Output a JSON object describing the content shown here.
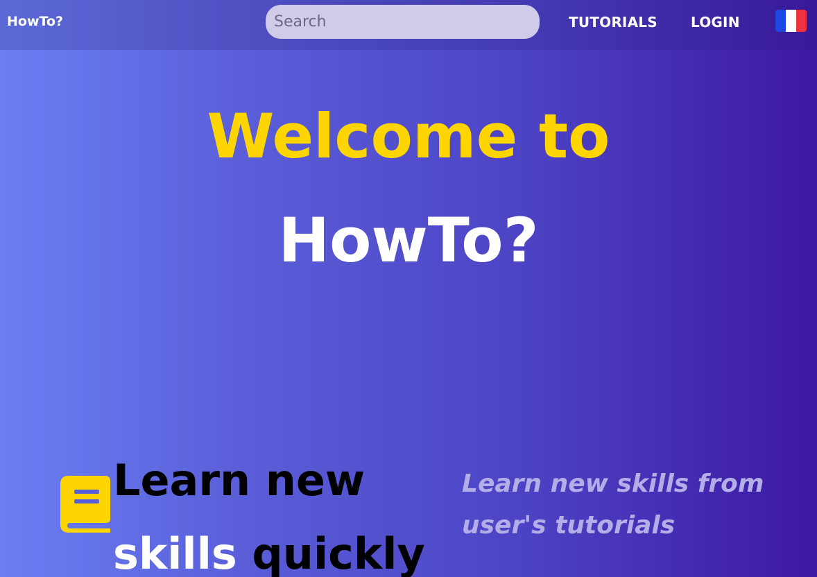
{
  "navbar": {
    "brand": "HowTo?",
    "search_placeholder": "Search",
    "links": [
      {
        "label": "TUTORIALS"
      },
      {
        "label": "LOGIN"
      }
    ],
    "language_flag": "france-flag-icon"
  },
  "hero": {
    "line1": "Welcome to",
    "line2": "HowTo?"
  },
  "feature": {
    "icon": "book-icon",
    "title_part1": "Learn new",
    "title_part2_white": "skills",
    "title_part3": " quickly",
    "subtitle": "Learn new skills from user's tutorials"
  },
  "colors": {
    "accent_yellow": "#ffd500",
    "gradient_start": "#6a7ff2",
    "gradient_end": "#3d18a2",
    "subtitle": "#b4aee8",
    "flag_blue": "#1d47e4",
    "flag_white": "#ffffff",
    "flag_red": "#f0323f"
  }
}
